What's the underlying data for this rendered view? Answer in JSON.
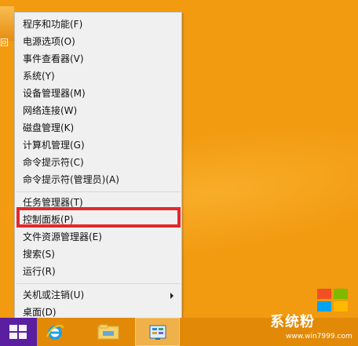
{
  "context_menu": {
    "items": [
      {
        "label": "程序和功能(F)"
      },
      {
        "label": "电源选项(O)"
      },
      {
        "label": "事件查看器(V)"
      },
      {
        "label": "系统(Y)"
      },
      {
        "label": "设备管理器(M)"
      },
      {
        "label": "网络连接(W)"
      },
      {
        "label": "磁盘管理(K)"
      },
      {
        "label": "计算机管理(G)"
      },
      {
        "label": "命令提示符(C)"
      },
      {
        "label": "命令提示符(管理员)(A)"
      },
      {
        "label": "任务管理器(T)"
      },
      {
        "label": "控制面板(P)"
      },
      {
        "label": "文件资源管理器(E)"
      },
      {
        "label": "搜索(S)"
      },
      {
        "label": "运行(R)"
      },
      {
        "label": "关机或注销(U)"
      },
      {
        "label": "桌面(D)"
      }
    ]
  },
  "taskbar": {
    "buttons": [
      {
        "icon": "windows-logo-icon"
      },
      {
        "icon": "internet-explorer-icon"
      },
      {
        "icon": "file-explorer-icon"
      },
      {
        "icon": "control-panel-icon"
      }
    ]
  },
  "watermark": {
    "text": "系统粉",
    "url": "www.win7999.com"
  },
  "desktop": {
    "edge_label": "回"
  },
  "colors": {
    "desktop": "#f29a10",
    "taskbar": "#e28a08",
    "start": "#5b1ea0",
    "highlight": "#e3282b",
    "menu_bg": "#f0f0f0"
  }
}
